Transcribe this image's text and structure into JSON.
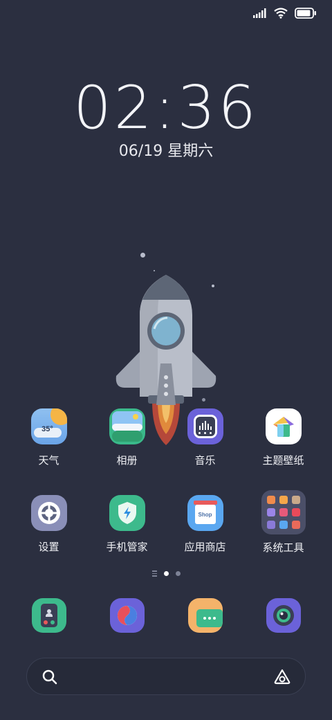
{
  "lockscreen": {
    "time": "02:36",
    "date": "06/19 星期六"
  },
  "status": {
    "signal_icon": "signal-bars-icon",
    "wifi_icon": "wifi-icon",
    "battery_icon": "battery-icon",
    "battery_level": 0.9
  },
  "apps_row1": [
    {
      "label": "天气",
      "icon": "weather-icon",
      "badge": "35°"
    },
    {
      "label": "相册",
      "icon": "gallery-icon"
    },
    {
      "label": "音乐",
      "icon": "music-icon"
    },
    {
      "label": "主题壁纸",
      "icon": "themes-icon"
    }
  ],
  "apps_row2": [
    {
      "label": "设置",
      "icon": "settings-icon"
    },
    {
      "label": "手机管家",
      "icon": "security-icon"
    },
    {
      "label": "应用商店",
      "icon": "app-store-icon",
      "badge": "Shop"
    },
    {
      "label": "系统工具",
      "icon": "system-tools-folder-icon"
    }
  ],
  "dock": [
    {
      "icon": "phone-icon"
    },
    {
      "icon": "browser-icon"
    },
    {
      "icon": "messages-icon"
    },
    {
      "icon": "camera-icon"
    }
  ],
  "page_indicator": {
    "pages": 2,
    "current": 1
  },
  "search": {
    "icon": "search-icon",
    "assistant_icon": "assistant-icon"
  },
  "colors": {
    "background": "#2b2f40",
    "accent_green": "#3dba8c",
    "accent_purple": "#6b62d9"
  }
}
